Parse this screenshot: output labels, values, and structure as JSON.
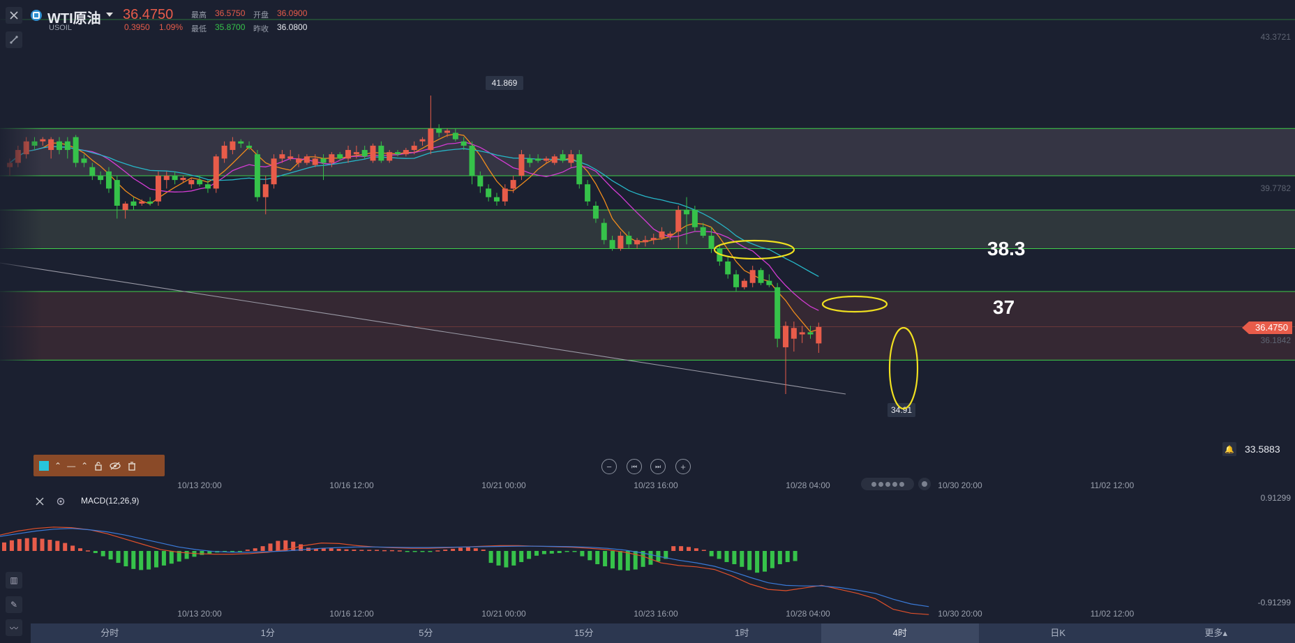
{
  "header": {
    "symbol": "WTI原油",
    "sub_symbol": "USOIL",
    "price": "36.4750",
    "change": "0.3950",
    "change_pct": "1.09%",
    "high_label": "最高",
    "high": "36.5750",
    "open_label": "开盘",
    "open": "36.0900",
    "low_label": "最低",
    "low": "35.8700",
    "prev_close_label": "昨收",
    "prev_close": "36.0800"
  },
  "price_scale": {
    "top": "43.3721",
    "mid": "39.7782",
    "current_price_tag": "36.4750",
    "ma_value": "36.1842",
    "alert_value": "33.5883"
  },
  "annotations": {
    "peak_label": "41.869",
    "low_label": "34.91",
    "level_1": "38.3",
    "level_2": "37"
  },
  "time_axis": [
    "10/13 20:00",
    "10/16 12:00",
    "10/21 00:00",
    "10/23 16:00",
    "10/28 04:00",
    "10/30 20:00",
    "11/02 12:00"
  ],
  "macd": {
    "name": "MACD(12,26,9)",
    "scale_top": "0.91299",
    "scale_bottom": "-0.91299"
  },
  "tabs": [
    {
      "label": "分时",
      "active": false
    },
    {
      "label": "1分",
      "active": false
    },
    {
      "label": "5分",
      "active": false
    },
    {
      "label": "15分",
      "active": false
    },
    {
      "label": "1时",
      "active": false
    },
    {
      "label": "4时",
      "active": true
    },
    {
      "label": "日K",
      "active": false
    },
    {
      "label": "更多▴",
      "active": false
    }
  ],
  "colors": {
    "up": "#e85c4a",
    "down": "#36c24a",
    "level_line": "#3fd04a",
    "ellipse": "#f0e020",
    "ma_fast": "#f08c1c",
    "ma_mid": "#d43cd4",
    "ma_slow": "#27b7c8",
    "macd_dif": "#e0502a",
    "macd_dea": "#3a7ad8"
  },
  "chart_data": {
    "type": "candlestick",
    "title": "WTI原油 4时",
    "level_lines": [
      41.1,
      40.0,
      39.2,
      38.3,
      37.3,
      35.7
    ],
    "candles": [
      {
        "t": 1,
        "o": 40.2,
        "h": 40.4,
        "l": 40.0,
        "c": 40.3
      },
      {
        "t": 2,
        "o": 40.3,
        "h": 40.7,
        "l": 40.2,
        "c": 40.6
      },
      {
        "t": 3,
        "o": 40.5,
        "h": 40.9,
        "l": 40.4,
        "c": 40.8
      },
      {
        "t": 4,
        "o": 40.8,
        "h": 40.9,
        "l": 40.6,
        "c": 40.7
      },
      {
        "t": 5,
        "o": 40.8,
        "h": 40.9,
        "l": 40.7,
        "c": 40.85
      },
      {
        "t": 6,
        "o": 40.6,
        "h": 40.9,
        "l": 40.4,
        "c": 40.85
      },
      {
        "t": 7,
        "o": 40.8,
        "h": 40.9,
        "l": 40.5,
        "c": 40.6
      },
      {
        "t": 8,
        "o": 40.8,
        "h": 40.9,
        "l": 40.4,
        "c": 40.6
      },
      {
        "t": 9,
        "o": 40.9,
        "h": 40.95,
        "l": 40.2,
        "c": 40.3
      },
      {
        "t": 10,
        "o": 40.4,
        "h": 40.5,
        "l": 40.2,
        "c": 40.3
      },
      {
        "t": 11,
        "o": 40.2,
        "h": 40.3,
        "l": 39.9,
        "c": 40.0
      },
      {
        "t": 12,
        "o": 40.0,
        "h": 40.1,
        "l": 39.8,
        "c": 39.9
      },
      {
        "t": 13,
        "o": 40.1,
        "h": 40.2,
        "l": 39.6,
        "c": 39.7
      },
      {
        "t": 14,
        "o": 39.9,
        "h": 40.0,
        "l": 39.0,
        "c": 39.3
      },
      {
        "t": 15,
        "o": 39.2,
        "h": 39.4,
        "l": 39.0,
        "c": 39.35
      },
      {
        "t": 16,
        "o": 39.4,
        "h": 39.5,
        "l": 39.2,
        "c": 39.3
      },
      {
        "t": 17,
        "o": 39.35,
        "h": 39.45,
        "l": 39.3,
        "c": 39.4
      },
      {
        "t": 18,
        "o": 39.4,
        "h": 39.5,
        "l": 39.3,
        "c": 39.35
      },
      {
        "t": 19,
        "o": 39.4,
        "h": 40.1,
        "l": 39.3,
        "c": 40.0
      },
      {
        "t": 20,
        "o": 39.9,
        "h": 40.1,
        "l": 39.7,
        "c": 40.0
      },
      {
        "t": 21,
        "o": 40.0,
        "h": 40.1,
        "l": 39.8,
        "c": 39.9
      },
      {
        "t": 22,
        "o": 39.9,
        "h": 40.0,
        "l": 39.85,
        "c": 39.95
      },
      {
        "t": 23,
        "o": 39.8,
        "h": 39.95,
        "l": 39.7,
        "c": 39.9
      },
      {
        "t": 24,
        "o": 39.9,
        "h": 40.0,
        "l": 39.75,
        "c": 39.8
      },
      {
        "t": 25,
        "o": 39.8,
        "h": 39.9,
        "l": 39.6,
        "c": 39.7
      },
      {
        "t": 26,
        "o": 39.7,
        "h": 40.5,
        "l": 39.6,
        "c": 40.45
      },
      {
        "t": 27,
        "o": 40.4,
        "h": 40.8,
        "l": 40.3,
        "c": 40.7
      },
      {
        "t": 28,
        "o": 40.6,
        "h": 40.9,
        "l": 40.5,
        "c": 40.8
      },
      {
        "t": 29,
        "o": 40.8,
        "h": 40.85,
        "l": 40.65,
        "c": 40.75
      },
      {
        "t": 30,
        "o": 40.7,
        "h": 40.8,
        "l": 40.6,
        "c": 40.65
      },
      {
        "t": 31,
        "o": 40.5,
        "h": 40.6,
        "l": 39.4,
        "c": 39.5
      },
      {
        "t": 32,
        "o": 39.5,
        "h": 40.0,
        "l": 39.1,
        "c": 39.8
      },
      {
        "t": 33,
        "o": 39.8,
        "h": 40.5,
        "l": 39.7,
        "c": 40.4
      },
      {
        "t": 34,
        "o": 40.4,
        "h": 40.6,
        "l": 40.3,
        "c": 40.5
      },
      {
        "t": 35,
        "o": 40.4,
        "h": 40.6,
        "l": 40.35,
        "c": 40.45
      },
      {
        "t": 36,
        "o": 40.3,
        "h": 40.5,
        "l": 40.2,
        "c": 40.4
      },
      {
        "t": 37,
        "o": 40.3,
        "h": 40.5,
        "l": 40.25,
        "c": 40.45
      },
      {
        "t": 38,
        "o": 40.25,
        "h": 40.5,
        "l": 40.2,
        "c": 40.4
      },
      {
        "t": 39,
        "o": 40.4,
        "h": 40.5,
        "l": 39.9,
        "c": 40.3
      },
      {
        "t": 40,
        "o": 40.3,
        "h": 40.55,
        "l": 40.2,
        "c": 40.5
      },
      {
        "t": 41,
        "o": 40.5,
        "h": 40.55,
        "l": 40.35,
        "c": 40.4
      },
      {
        "t": 42,
        "o": 40.4,
        "h": 40.7,
        "l": 40.3,
        "c": 40.6
      },
      {
        "t": 43,
        "o": 40.5,
        "h": 40.7,
        "l": 40.4,
        "c": 40.55
      },
      {
        "t": 44,
        "o": 40.6,
        "h": 40.7,
        "l": 40.4,
        "c": 40.45
      },
      {
        "t": 45,
        "o": 40.35,
        "h": 40.75,
        "l": 40.3,
        "c": 40.7
      },
      {
        "t": 46,
        "o": 40.7,
        "h": 40.8,
        "l": 40.3,
        "c": 40.35
      },
      {
        "t": 47,
        "o": 40.35,
        "h": 40.6,
        "l": 40.3,
        "c": 40.55
      },
      {
        "t": 48,
        "o": 40.55,
        "h": 40.6,
        "l": 40.45,
        "c": 40.5
      },
      {
        "t": 49,
        "o": 40.5,
        "h": 40.65,
        "l": 40.45,
        "c": 40.6
      },
      {
        "t": 50,
        "o": 40.6,
        "h": 40.8,
        "l": 40.5,
        "c": 40.7
      },
      {
        "t": 51,
        "o": 40.8,
        "h": 40.9,
        "l": 40.7,
        "c": 40.85
      },
      {
        "t": 52,
        "o": 40.6,
        "h": 41.869,
        "l": 40.5,
        "c": 41.1
      },
      {
        "t": 53,
        "o": 41.1,
        "h": 41.2,
        "l": 40.9,
        "c": 41.0
      },
      {
        "t": 54,
        "o": 41.0,
        "h": 41.1,
        "l": 40.9,
        "c": 41.05
      },
      {
        "t": 55,
        "o": 41.0,
        "h": 41.1,
        "l": 40.8,
        "c": 40.85
      },
      {
        "t": 56,
        "o": 40.8,
        "h": 40.9,
        "l": 40.6,
        "c": 40.7
      },
      {
        "t": 57,
        "o": 40.7,
        "h": 40.8,
        "l": 39.8,
        "c": 40.0
      },
      {
        "t": 58,
        "o": 40.0,
        "h": 40.1,
        "l": 39.6,
        "c": 39.75
      },
      {
        "t": 59,
        "o": 39.7,
        "h": 39.8,
        "l": 39.4,
        "c": 39.5
      },
      {
        "t": 60,
        "o": 39.5,
        "h": 39.6,
        "l": 39.3,
        "c": 39.4
      },
      {
        "t": 61,
        "o": 39.4,
        "h": 39.8,
        "l": 39.3,
        "c": 39.7
      },
      {
        "t": 62,
        "o": 39.7,
        "h": 40.0,
        "l": 39.6,
        "c": 39.9
      },
      {
        "t": 63,
        "o": 40.0,
        "h": 40.6,
        "l": 39.9,
        "c": 40.5
      },
      {
        "t": 64,
        "o": 40.4,
        "h": 40.5,
        "l": 40.2,
        "c": 40.3
      },
      {
        "t": 65,
        "o": 40.4,
        "h": 40.5,
        "l": 40.3,
        "c": 40.35
      },
      {
        "t": 66,
        "o": 40.35,
        "h": 40.45,
        "l": 40.3,
        "c": 40.4
      },
      {
        "t": 67,
        "o": 40.3,
        "h": 40.5,
        "l": 40.25,
        "c": 40.45
      },
      {
        "t": 68,
        "o": 40.5,
        "h": 40.6,
        "l": 40.3,
        "c": 40.35
      },
      {
        "t": 69,
        "o": 40.3,
        "h": 40.6,
        "l": 40.2,
        "c": 40.5
      },
      {
        "t": 70,
        "o": 40.5,
        "h": 40.6,
        "l": 39.7,
        "c": 39.8
      },
      {
        "t": 71,
        "o": 39.8,
        "h": 39.9,
        "l": 39.3,
        "c": 39.4
      },
      {
        "t": 72,
        "o": 39.3,
        "h": 39.4,
        "l": 38.9,
        "c": 39.0
      },
      {
        "t": 73,
        "o": 38.9,
        "h": 39.0,
        "l": 38.4,
        "c": 38.5
      },
      {
        "t": 74,
        "o": 38.5,
        "h": 38.6,
        "l": 38.25,
        "c": 38.3
      },
      {
        "t": 75,
        "o": 38.3,
        "h": 38.7,
        "l": 38.25,
        "c": 38.6
      },
      {
        "t": 76,
        "o": 38.6,
        "h": 38.7,
        "l": 38.3,
        "c": 38.4
      },
      {
        "t": 77,
        "o": 38.4,
        "h": 38.55,
        "l": 38.3,
        "c": 38.5
      },
      {
        "t": 78,
        "o": 38.45,
        "h": 38.6,
        "l": 38.35,
        "c": 38.5
      },
      {
        "t": 79,
        "o": 38.5,
        "h": 38.65,
        "l": 38.4,
        "c": 38.55
      },
      {
        "t": 80,
        "o": 38.55,
        "h": 38.8,
        "l": 38.5,
        "c": 38.7
      },
      {
        "t": 81,
        "o": 38.6,
        "h": 38.7,
        "l": 38.5,
        "c": 38.65
      },
      {
        "t": 82,
        "o": 38.7,
        "h": 39.3,
        "l": 38.3,
        "c": 39.2
      },
      {
        "t": 83,
        "o": 39.2,
        "h": 39.5,
        "l": 38.4,
        "c": 39.1
      },
      {
        "t": 84,
        "o": 39.2,
        "h": 39.3,
        "l": 38.7,
        "c": 38.8
      },
      {
        "t": 85,
        "o": 38.8,
        "h": 38.9,
        "l": 38.55,
        "c": 38.6
      },
      {
        "t": 86,
        "o": 38.6,
        "h": 38.8,
        "l": 38.2,
        "c": 38.3
      },
      {
        "t": 87,
        "o": 38.3,
        "h": 38.4,
        "l": 37.9,
        "c": 38.0
      },
      {
        "t": 88,
        "o": 38.0,
        "h": 38.1,
        "l": 37.6,
        "c": 37.7
      },
      {
        "t": 89,
        "o": 37.7,
        "h": 37.8,
        "l": 37.3,
        "c": 37.4
      },
      {
        "t": 90,
        "o": 37.4,
        "h": 37.6,
        "l": 37.35,
        "c": 37.55
      },
      {
        "t": 91,
        "o": 37.5,
        "h": 37.9,
        "l": 37.4,
        "c": 37.8
      },
      {
        "t": 92,
        "o": 37.8,
        "h": 37.85,
        "l": 37.45,
        "c": 37.5
      },
      {
        "t": 93,
        "o": 37.55,
        "h": 37.7,
        "l": 37.4,
        "c": 37.45
      },
      {
        "t": 94,
        "o": 37.4,
        "h": 37.5,
        "l": 36.0,
        "c": 36.2
      },
      {
        "t": 95,
        "o": 36.0,
        "h": 36.6,
        "l": 34.91,
        "c": 36.5
      },
      {
        "t": 96,
        "o": 36.2,
        "h": 36.6,
        "l": 35.9,
        "c": 36.45
      },
      {
        "t": 97,
        "o": 36.3,
        "h": 36.5,
        "l": 36.1,
        "c": 36.35
      },
      {
        "t": 98,
        "o": 36.35,
        "h": 36.5,
        "l": 36.2,
        "c": 36.3
      },
      {
        "t": 99,
        "o": 36.09,
        "h": 36.575,
        "l": 35.87,
        "c": 36.475
      }
    ],
    "macd_hist": [
      0.32,
      0.4,
      0.45,
      0.48,
      0.5,
      0.46,
      0.42,
      0.38,
      0.3,
      0.2,
      0.1,
      0.02,
      -0.08,
      -0.2,
      -0.32,
      -0.45,
      -0.58,
      -0.68,
      -0.72,
      -0.7,
      -0.62,
      -0.55,
      -0.48,
      -0.4,
      -0.3,
      -0.22,
      -0.15,
      -0.1,
      -0.06,
      -0.04,
      -0.03,
      -0.02,
      0.05,
      0.1,
      0.18,
      0.28,
      0.38,
      0.4,
      0.35,
      0.25,
      0.12,
      0.08,
      0.1,
      0.1,
      0.08,
      0.06,
      0.05,
      0.04,
      0.04,
      0.04,
      0.03,
      0.03,
      0.02,
      -0.02,
      -0.02,
      -0.02,
      -0.02,
      0.02,
      0.05,
      0.08,
      0.12,
      0.14,
      0.1,
      0.05,
      -0.45,
      -0.55,
      -0.62,
      -0.55,
      -0.42,
      -0.3,
      -0.18,
      -0.12,
      -0.1,
      -0.08,
      -0.03,
      -0.02,
      -0.2,
      -0.35,
      -0.5,
      -0.58,
      -0.66,
      -0.72,
      -0.74,
      -0.7,
      -0.6,
      -0.52,
      -0.4,
      -0.3,
      0.18,
      0.18,
      0.15,
      0.1,
      0.04,
      -0.2,
      -0.3,
      -0.42,
      -0.5,
      -0.6,
      -0.72,
      -0.82,
      -0.78,
      -0.65,
      -0.5,
      -0.42,
      -0.38
    ],
    "macd_dif": [
      0.6,
      0.75,
      0.85,
      0.9,
      0.88,
      0.8,
      0.65,
      0.45,
      0.25,
      0.05,
      -0.05,
      -0.1,
      -0.12,
      -0.12,
      -0.1,
      -0.05,
      0.05,
      0.2,
      0.3,
      0.28,
      0.2,
      0.15,
      0.12,
      0.1,
      0.1,
      0.12,
      0.15,
      0.18,
      0.2,
      0.2,
      0.18,
      0.16,
      0.14,
      0.1,
      0.05,
      -0.05,
      -0.2,
      -0.45,
      -0.55,
      -0.6,
      -0.7,
      -0.95,
      -1.25,
      -1.45,
      -1.5,
      -1.4,
      -1.3,
      -1.45,
      -1.6,
      -1.8,
      -2.2,
      -2.35,
      -2.4
    ],
    "macd_dea": [
      0.55,
      0.65,
      0.75,
      0.82,
      0.85,
      0.8,
      0.72,
      0.6,
      0.45,
      0.3,
      0.15,
      0.05,
      -0.02,
      -0.05,
      -0.05,
      -0.03,
      0.0,
      0.05,
      0.1,
      0.13,
      0.15,
      0.15,
      0.14,
      0.13,
      0.13,
      0.14,
      0.15,
      0.16,
      0.17,
      0.18,
      0.18,
      0.17,
      0.16,
      0.14,
      0.1,
      0.03,
      -0.08,
      -0.22,
      -0.35,
      -0.45,
      -0.58,
      -0.78,
      -1.0,
      -1.2,
      -1.3,
      -1.32,
      -1.32,
      -1.38,
      -1.48,
      -1.6,
      -1.82,
      -2.0,
      -2.1
    ]
  }
}
